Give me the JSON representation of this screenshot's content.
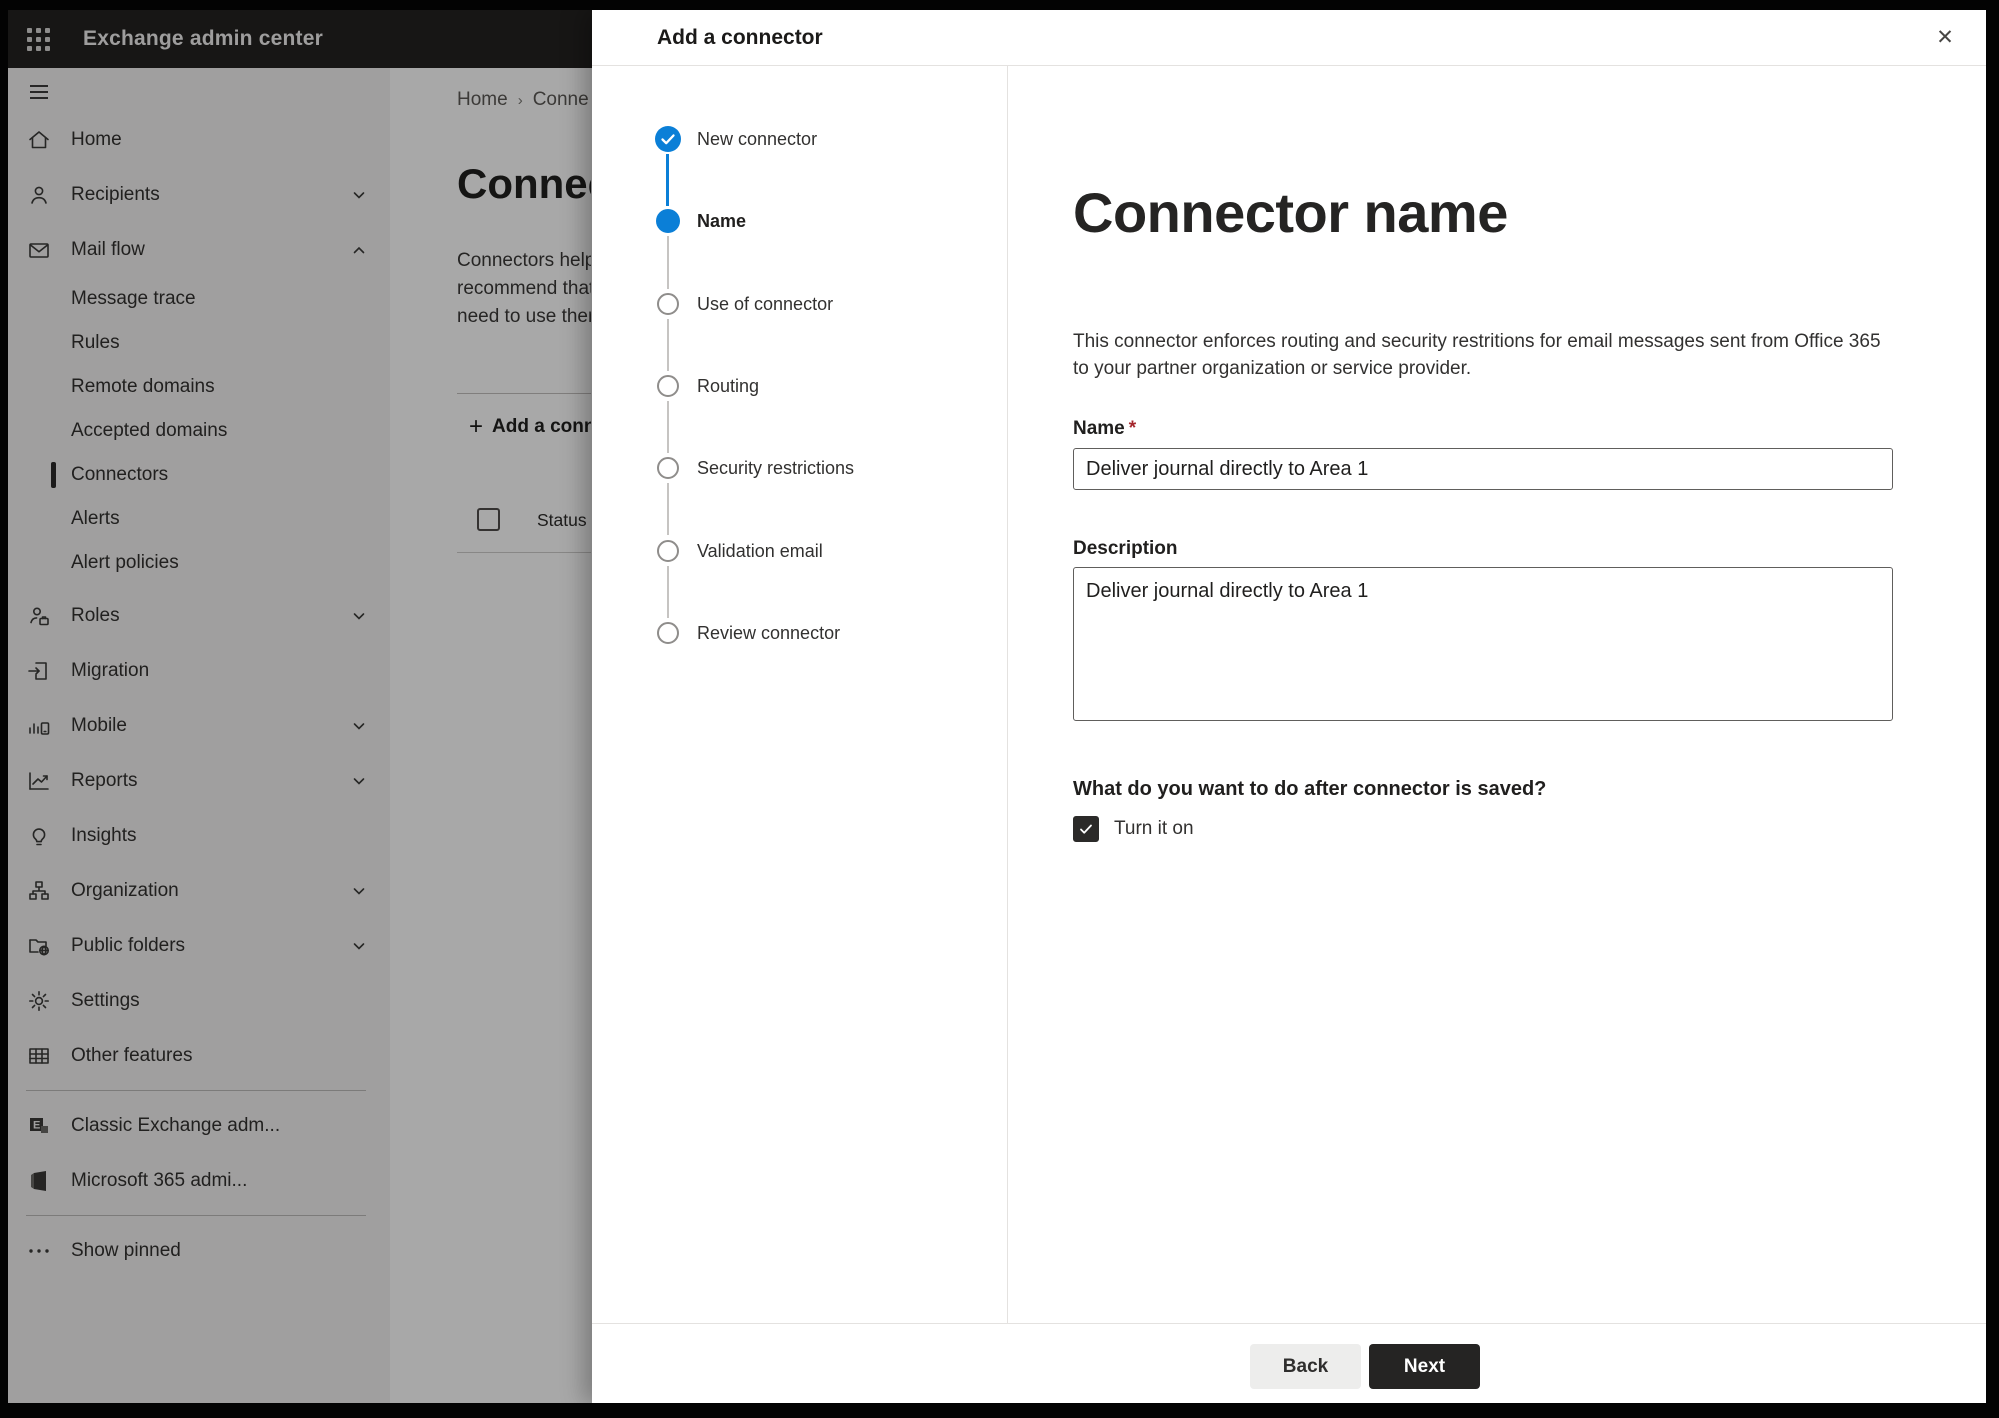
{
  "topbar": {
    "title": "Exchange admin center"
  },
  "sidebar": {
    "items": [
      {
        "label": "Home",
        "icon": "home",
        "type": "top"
      },
      {
        "label": "Recipients",
        "icon": "person",
        "type": "top",
        "chevron": "down"
      },
      {
        "label": "Mail flow",
        "icon": "mail",
        "type": "top",
        "chevron": "up"
      },
      {
        "label": "Message trace",
        "type": "sub"
      },
      {
        "label": "Rules",
        "type": "sub"
      },
      {
        "label": "Remote domains",
        "type": "sub"
      },
      {
        "label": "Accepted domains",
        "type": "sub"
      },
      {
        "label": "Connectors",
        "type": "sub",
        "selected": true
      },
      {
        "label": "Alerts",
        "type": "sub"
      },
      {
        "label": "Alert policies",
        "type": "sub"
      },
      {
        "label": "Roles",
        "icon": "person-badge",
        "type": "top",
        "chevron": "down"
      },
      {
        "label": "Migration",
        "icon": "migration",
        "type": "top"
      },
      {
        "label": "Mobile",
        "icon": "mobile",
        "type": "top",
        "chevron": "down"
      },
      {
        "label": "Reports",
        "icon": "chart",
        "type": "top",
        "chevron": "down"
      },
      {
        "label": "Insights",
        "icon": "lightbulb",
        "type": "top"
      },
      {
        "label": "Organization",
        "icon": "org",
        "type": "top",
        "chevron": "down"
      },
      {
        "label": "Public folders",
        "icon": "folder-globe",
        "type": "top",
        "chevron": "down"
      },
      {
        "label": "Settings",
        "icon": "gear",
        "type": "top"
      },
      {
        "label": "Other features",
        "icon": "grid",
        "type": "top"
      },
      {
        "type": "divider"
      },
      {
        "label": "Classic Exchange adm...",
        "icon": "exchange-logo",
        "type": "top"
      },
      {
        "label": "Microsoft 365 admi...",
        "icon": "office-logo",
        "type": "top"
      },
      {
        "type": "divider"
      },
      {
        "label": "Show pinned",
        "icon": "ellipsis",
        "type": "top"
      }
    ]
  },
  "background": {
    "breadcrumb": [
      "Home",
      "Conne"
    ],
    "page_title": "Connect",
    "intro_lines": [
      "Connectors help",
      "recommend that",
      "need to use ther"
    ],
    "add_button": "Add a conn",
    "table_header": "Status"
  },
  "modal": {
    "title": "Add a connector",
    "steps": [
      {
        "label": "New connector",
        "state": "completed"
      },
      {
        "label": "Name",
        "state": "current"
      },
      {
        "label": "Use of connector",
        "state": "upcoming"
      },
      {
        "label": "Routing",
        "state": "upcoming"
      },
      {
        "label": "Security restrictions",
        "state": "upcoming"
      },
      {
        "label": "Validation email",
        "state": "upcoming"
      },
      {
        "label": "Review connector",
        "state": "upcoming"
      }
    ],
    "content": {
      "heading": "Connector name",
      "description_lines": [
        "This connector enforces routing and security restritions for email messages sent from Office 365",
        "to your partner organization or service provider."
      ],
      "name_label": "Name",
      "required_mark": "*",
      "name_value": "Deliver journal directly to Area 1",
      "description_label": "Description",
      "description_value": "Deliver journal directly to Area 1",
      "question": "What do you want to do after connector is saved?",
      "checkbox_label": "Turn it on",
      "checkbox_checked": true
    },
    "footer": {
      "back_label": "Back",
      "next_label": "Next"
    }
  },
  "icons": {
    "close": "✕",
    "add_plus": "+",
    "breadcrumb_separator": "›"
  },
  "colors": {
    "accent_blue": "#0b7fd7",
    "topbar_bg": "#232221",
    "sidebar_bg": "#f3f2f1",
    "dark_button": "#252423",
    "required_red": "#a4262c"
  }
}
